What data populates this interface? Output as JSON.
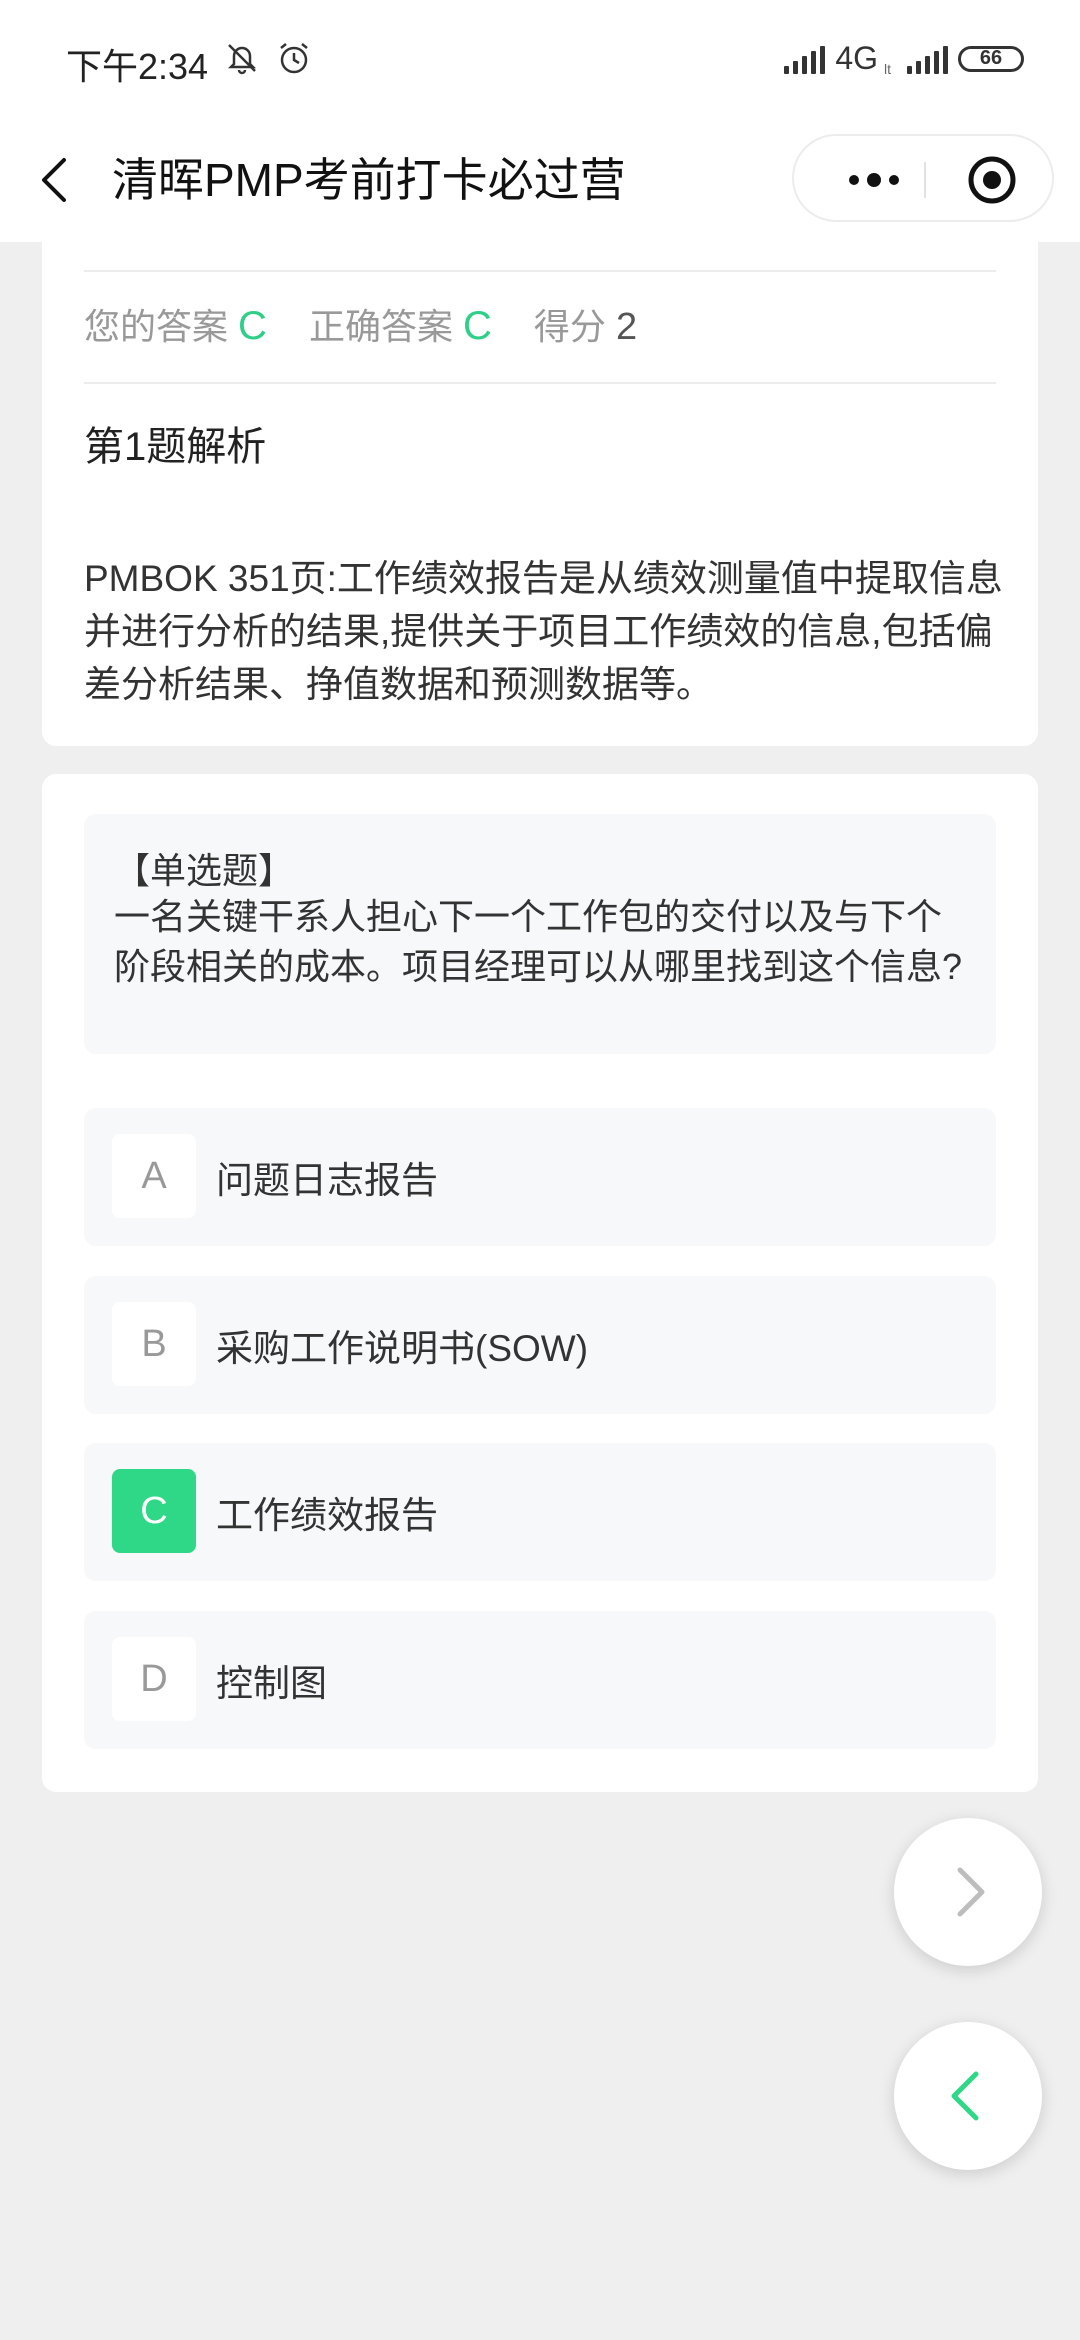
{
  "status_bar": {
    "time": "下午2:34",
    "network": "4G",
    "network_sub": "lt",
    "battery": "66"
  },
  "nav": {
    "title": "清晖PMP考前打卡必过营"
  },
  "result": {
    "your_answer_label": "您的答案",
    "your_answer": "C",
    "correct_answer_label": "正确答案",
    "correct_answer": "C",
    "score_label": "得分",
    "score": "2"
  },
  "analysis": {
    "title": "第1题解析",
    "text": "PMBOK 351页:工作绩效报告是从绩效测量值中提取信息并进行分析的结果,提供关于项目工作绩效的信息,包括偏差分析结果、挣值数据和预测数据等。"
  },
  "question": {
    "type": "【单选题】",
    "text": "一名关键干系人担心下一个工作包的交付以及与下个阶段相关的成本。项目经理可以从哪里找到这个信息?",
    "options": [
      {
        "letter": "A",
        "text": "问题日志报告"
      },
      {
        "letter": "B",
        "text": "采购工作说明书(SOW)"
      },
      {
        "letter": "C",
        "text": "工作绩效报告"
      },
      {
        "letter": "D",
        "text": "控制图"
      }
    ]
  },
  "colors": {
    "accent": "#2fd886",
    "answer_text": "#2fcf8a"
  }
}
